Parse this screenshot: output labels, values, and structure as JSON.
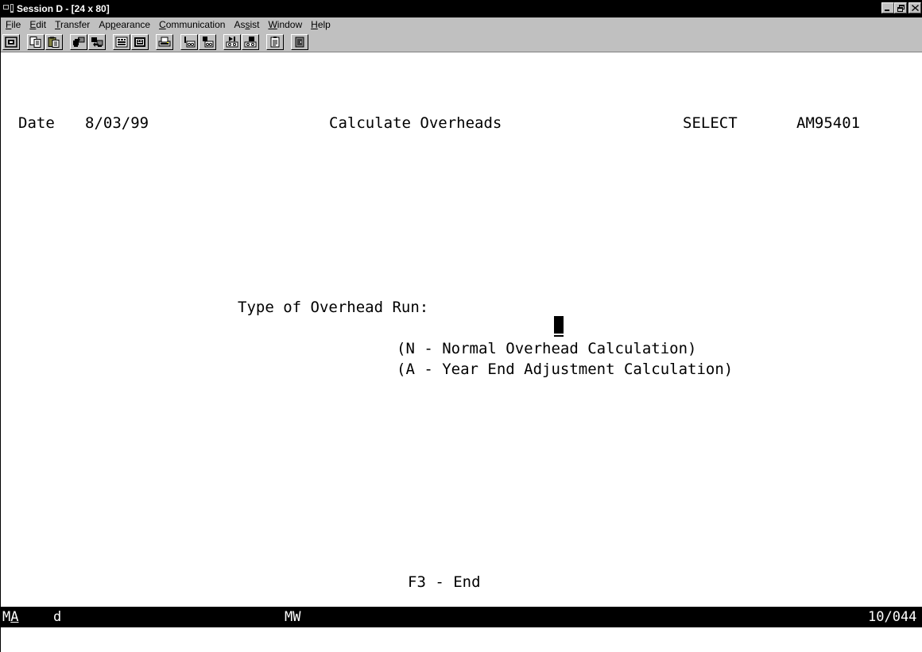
{
  "window": {
    "title": "Session D - [24 x 80]",
    "controls": {
      "minimize": "_",
      "maximize": "Θ",
      "close": "×"
    }
  },
  "menubar": {
    "items": [
      {
        "pre": "",
        "accel": "F",
        "post": "ile"
      },
      {
        "pre": "",
        "accel": "E",
        "post": "dit"
      },
      {
        "pre": "",
        "accel": "T",
        "post": "ransfer"
      },
      {
        "pre": "Ap",
        "accel": "p",
        "post": "earance"
      },
      {
        "pre": "",
        "accel": "C",
        "post": "ommunication"
      },
      {
        "pre": "As",
        "accel": "s",
        "post": "ist"
      },
      {
        "pre": "",
        "accel": "W",
        "post": "indow"
      },
      {
        "pre": "",
        "accel": "H",
        "post": "elp"
      }
    ]
  },
  "toolbar": {
    "buttons": [
      "screen-capture-icon",
      "copy-icon",
      "paste-icon",
      "send-file-icon",
      "receive-file-icon",
      "keypad-icon",
      "macro-icon",
      "print-screen-icon",
      "play-macro-icon",
      "record-macro-icon",
      "start-macro-icon",
      "stop-macro-icon",
      "clipboard-icon",
      "exit-icon"
    ]
  },
  "terminal": {
    "date_label": "Date",
    "date_value": "8/03/99",
    "screen_title": "Calculate Overheads",
    "mode": "SELECT",
    "program_id": "AM95401",
    "prompt_label": "Type of Overhead Run:",
    "option_n": "(N - Normal Overhead Calculation)",
    "option_a": "(A - Year End Adjustment Calculation)",
    "function_key": "F3 - End"
  },
  "statusbar": {
    "ma": "MA",
    "session_indicator": "d",
    "mw": "MW",
    "cursor_position": "10/044"
  }
}
